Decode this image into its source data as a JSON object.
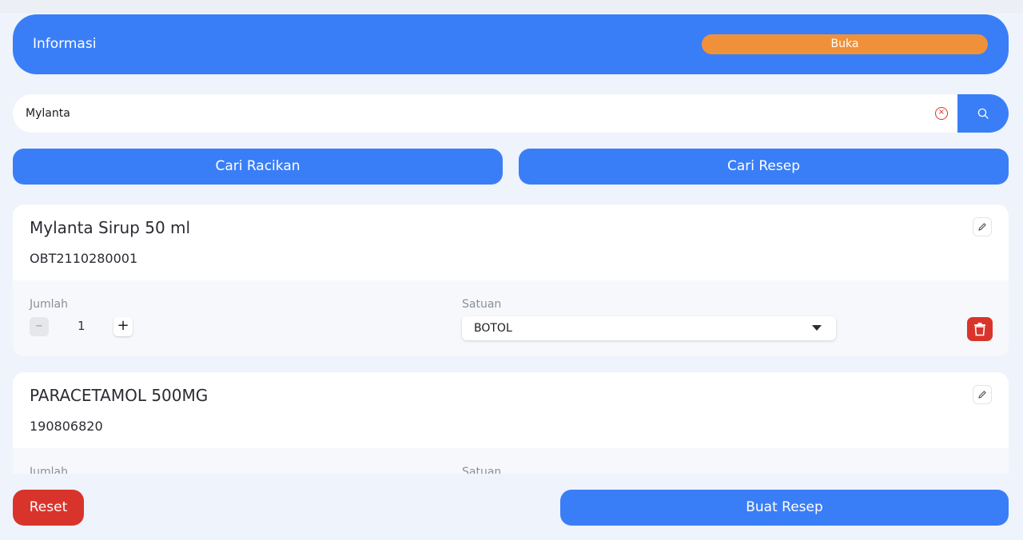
{
  "header": {
    "title": "Informasi",
    "status": "Buka"
  },
  "search": {
    "value": "Mylanta",
    "placeholder": ""
  },
  "actions": {
    "racikan_label": "Cari Racikan",
    "resep_label": "Cari Resep"
  },
  "items": [
    {
      "name": "Mylanta Sirup 50 ml",
      "code": "OBT2110280001",
      "quantity_label": "Jumlah",
      "quantity": "1",
      "unit_label": "Satuan",
      "unit": "BOTOL"
    },
    {
      "name": "PARACETAMOL 500MG",
      "code": "190806820",
      "quantity_label": "Jumlah",
      "unit_label": "Satuan"
    }
  ],
  "footer": {
    "reset_label": "Reset",
    "create_label": "Buat Resep"
  },
  "colors": {
    "primary": "#3a7ef7",
    "status_open": "#f0913a",
    "danger": "#d9342b",
    "background": "#eef3fc"
  },
  "icons": {
    "search": "search-icon",
    "clear": "clear-circle-icon",
    "edit": "pencil-icon",
    "delete": "trash-icon",
    "caret": "caret-down-icon",
    "minus": "minus-icon",
    "plus": "plus-icon"
  }
}
